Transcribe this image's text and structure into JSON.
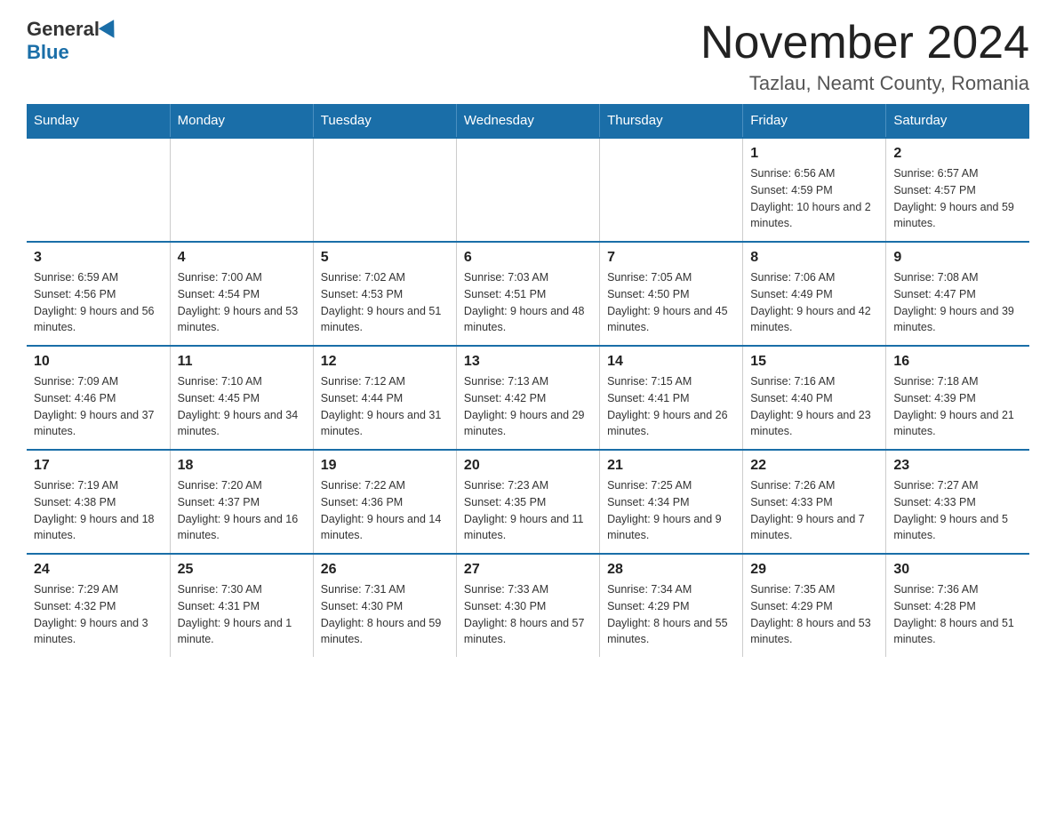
{
  "logo": {
    "general": "General",
    "blue": "Blue"
  },
  "title": {
    "month": "November 2024",
    "location": "Tazlau, Neamt County, Romania"
  },
  "weekdays": [
    "Sunday",
    "Monday",
    "Tuesday",
    "Wednesday",
    "Thursday",
    "Friday",
    "Saturday"
  ],
  "weeks": [
    [
      {
        "day": "",
        "info": ""
      },
      {
        "day": "",
        "info": ""
      },
      {
        "day": "",
        "info": ""
      },
      {
        "day": "",
        "info": ""
      },
      {
        "day": "",
        "info": ""
      },
      {
        "day": "1",
        "info": "Sunrise: 6:56 AM\nSunset: 4:59 PM\nDaylight: 10 hours and 2 minutes."
      },
      {
        "day": "2",
        "info": "Sunrise: 6:57 AM\nSunset: 4:57 PM\nDaylight: 9 hours and 59 minutes."
      }
    ],
    [
      {
        "day": "3",
        "info": "Sunrise: 6:59 AM\nSunset: 4:56 PM\nDaylight: 9 hours and 56 minutes."
      },
      {
        "day": "4",
        "info": "Sunrise: 7:00 AM\nSunset: 4:54 PM\nDaylight: 9 hours and 53 minutes."
      },
      {
        "day": "5",
        "info": "Sunrise: 7:02 AM\nSunset: 4:53 PM\nDaylight: 9 hours and 51 minutes."
      },
      {
        "day": "6",
        "info": "Sunrise: 7:03 AM\nSunset: 4:51 PM\nDaylight: 9 hours and 48 minutes."
      },
      {
        "day": "7",
        "info": "Sunrise: 7:05 AM\nSunset: 4:50 PM\nDaylight: 9 hours and 45 minutes."
      },
      {
        "day": "8",
        "info": "Sunrise: 7:06 AM\nSunset: 4:49 PM\nDaylight: 9 hours and 42 minutes."
      },
      {
        "day": "9",
        "info": "Sunrise: 7:08 AM\nSunset: 4:47 PM\nDaylight: 9 hours and 39 minutes."
      }
    ],
    [
      {
        "day": "10",
        "info": "Sunrise: 7:09 AM\nSunset: 4:46 PM\nDaylight: 9 hours and 37 minutes."
      },
      {
        "day": "11",
        "info": "Sunrise: 7:10 AM\nSunset: 4:45 PM\nDaylight: 9 hours and 34 minutes."
      },
      {
        "day": "12",
        "info": "Sunrise: 7:12 AM\nSunset: 4:44 PM\nDaylight: 9 hours and 31 minutes."
      },
      {
        "day": "13",
        "info": "Sunrise: 7:13 AM\nSunset: 4:42 PM\nDaylight: 9 hours and 29 minutes."
      },
      {
        "day": "14",
        "info": "Sunrise: 7:15 AM\nSunset: 4:41 PM\nDaylight: 9 hours and 26 minutes."
      },
      {
        "day": "15",
        "info": "Sunrise: 7:16 AM\nSunset: 4:40 PM\nDaylight: 9 hours and 23 minutes."
      },
      {
        "day": "16",
        "info": "Sunrise: 7:18 AM\nSunset: 4:39 PM\nDaylight: 9 hours and 21 minutes."
      }
    ],
    [
      {
        "day": "17",
        "info": "Sunrise: 7:19 AM\nSunset: 4:38 PM\nDaylight: 9 hours and 18 minutes."
      },
      {
        "day": "18",
        "info": "Sunrise: 7:20 AM\nSunset: 4:37 PM\nDaylight: 9 hours and 16 minutes."
      },
      {
        "day": "19",
        "info": "Sunrise: 7:22 AM\nSunset: 4:36 PM\nDaylight: 9 hours and 14 minutes."
      },
      {
        "day": "20",
        "info": "Sunrise: 7:23 AM\nSunset: 4:35 PM\nDaylight: 9 hours and 11 minutes."
      },
      {
        "day": "21",
        "info": "Sunrise: 7:25 AM\nSunset: 4:34 PM\nDaylight: 9 hours and 9 minutes."
      },
      {
        "day": "22",
        "info": "Sunrise: 7:26 AM\nSunset: 4:33 PM\nDaylight: 9 hours and 7 minutes."
      },
      {
        "day": "23",
        "info": "Sunrise: 7:27 AM\nSunset: 4:33 PM\nDaylight: 9 hours and 5 minutes."
      }
    ],
    [
      {
        "day": "24",
        "info": "Sunrise: 7:29 AM\nSunset: 4:32 PM\nDaylight: 9 hours and 3 minutes."
      },
      {
        "day": "25",
        "info": "Sunrise: 7:30 AM\nSunset: 4:31 PM\nDaylight: 9 hours and 1 minute."
      },
      {
        "day": "26",
        "info": "Sunrise: 7:31 AM\nSunset: 4:30 PM\nDaylight: 8 hours and 59 minutes."
      },
      {
        "day": "27",
        "info": "Sunrise: 7:33 AM\nSunset: 4:30 PM\nDaylight: 8 hours and 57 minutes."
      },
      {
        "day": "28",
        "info": "Sunrise: 7:34 AM\nSunset: 4:29 PM\nDaylight: 8 hours and 55 minutes."
      },
      {
        "day": "29",
        "info": "Sunrise: 7:35 AM\nSunset: 4:29 PM\nDaylight: 8 hours and 53 minutes."
      },
      {
        "day": "30",
        "info": "Sunrise: 7:36 AM\nSunset: 4:28 PM\nDaylight: 8 hours and 51 minutes."
      }
    ]
  ]
}
